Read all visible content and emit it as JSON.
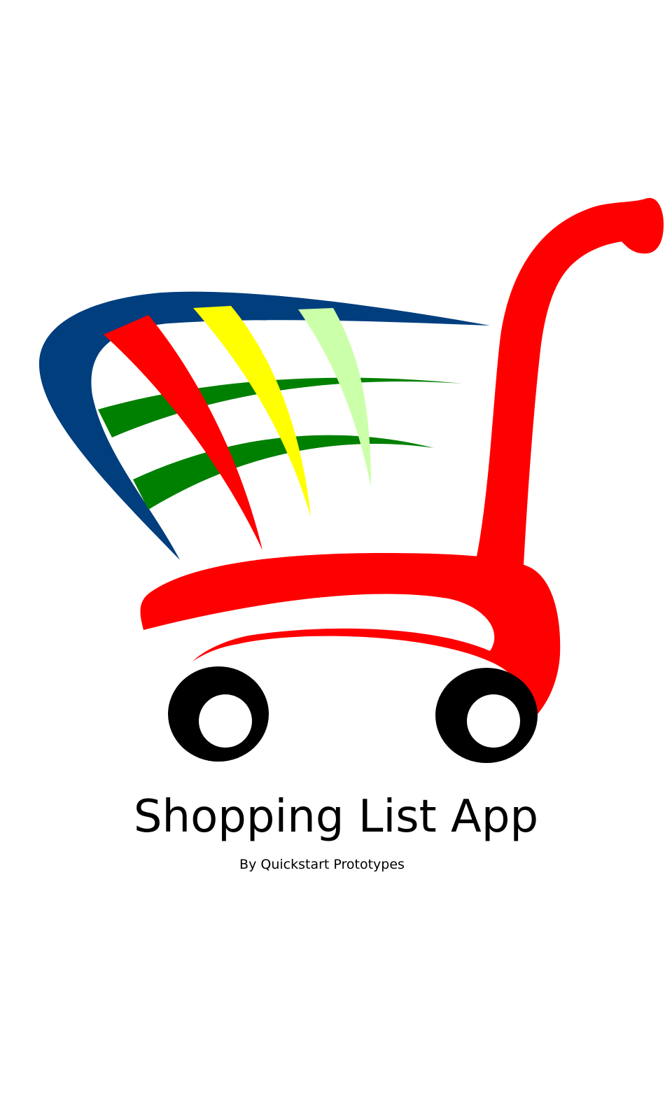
{
  "app": {
    "title": "Shopping List App",
    "subtitle": "By Quickstart Prototypes"
  },
  "logo": {
    "icon": "shopping-cart-icon",
    "colors": {
      "handle_and_frame": "#ff0000",
      "basket_back": "#003e7e",
      "stripe_red": "#ff0000",
      "stripe_yellow": "#ffff00",
      "stripe_light_green": "#ccffaa",
      "stripe_green": "#008000",
      "wheels": "#000000"
    }
  }
}
